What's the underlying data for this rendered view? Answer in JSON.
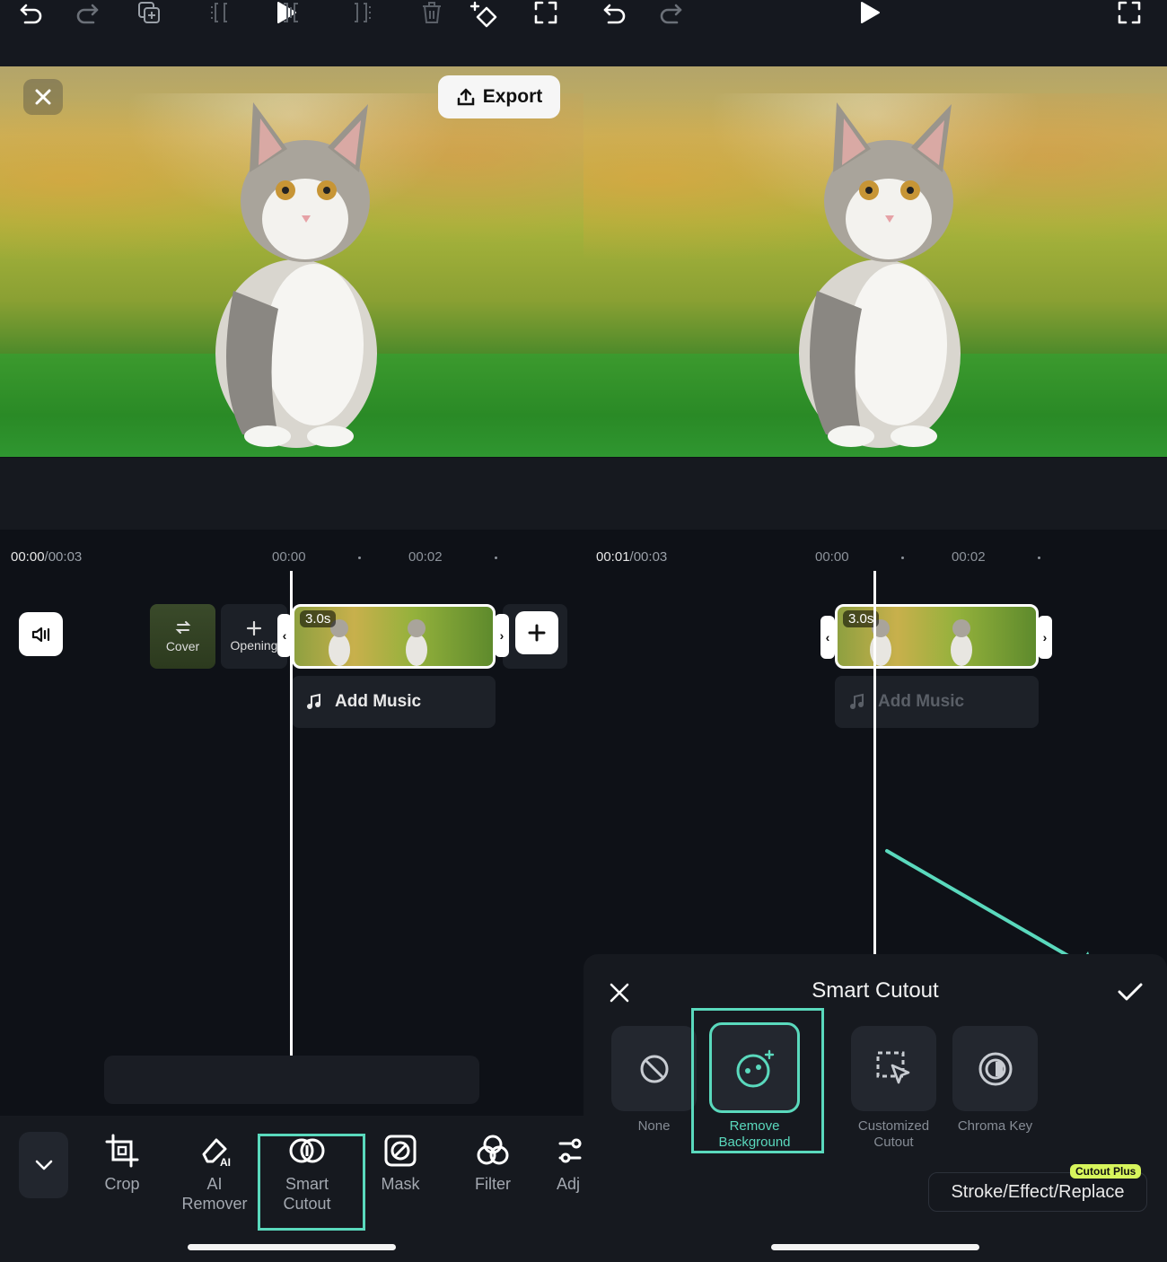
{
  "left_panel": {
    "export_label": "Export",
    "time": {
      "current": "00:00",
      "total": "/00:03"
    },
    "ruler": [
      "00:00",
      "00:02"
    ],
    "clip_duration": "3.0s",
    "cover_label": "Cover",
    "opening_label": "Opening",
    "add_music_label": "Add Music",
    "tools": [
      {
        "label": "Crop"
      },
      {
        "label": "AI Remover",
        "line1": "AI",
        "line2": "Remover"
      },
      {
        "label": "Smart Cutout",
        "line1": "Smart",
        "line2": "Cutout"
      },
      {
        "label": "Mask"
      },
      {
        "label": "Filter"
      },
      {
        "label": "Adj"
      }
    ]
  },
  "right_panel": {
    "time": {
      "current": "00:01",
      "total": "/00:03"
    },
    "ruler": [
      "00:00",
      "00:02"
    ],
    "clip_duration": "3.0s",
    "add_music_label": "Add Music",
    "sheet": {
      "title": "Smart Cutout",
      "options": [
        {
          "label": "None",
          "selected": false
        },
        {
          "label": "Remove Background",
          "line1": "Remove",
          "line2": "Background",
          "selected": true
        },
        {
          "label": "Customized Cutout",
          "line1": "Customized",
          "line2": "Cutout",
          "selected": false
        },
        {
          "label": "Chroma Key",
          "selected": false
        }
      ],
      "stroke_label": "Stroke/Effect/Replace",
      "badge_label": "Cutout Plus"
    }
  },
  "colors": {
    "accent": "#5ad9bd",
    "background": "#0e1117",
    "badge": "#d7f55c"
  },
  "icons": [
    "close-icon",
    "export-icon",
    "undo-icon",
    "redo-icon",
    "play-icon",
    "keyframe-icon",
    "fullscreen-icon",
    "volume-icon",
    "music-note-icon",
    "plus-icon",
    "copy-icon",
    "split-icon",
    "trim-icon",
    "delete-icon",
    "chevron-down-icon",
    "crop-icon",
    "ai-eraser-icon",
    "smart-cutout-icon",
    "mask-icon",
    "filter-icon",
    "adjust-icon",
    "none-icon",
    "remove-background-icon",
    "customized-cutout-icon",
    "chroma-key-icon",
    "check-icon"
  ]
}
